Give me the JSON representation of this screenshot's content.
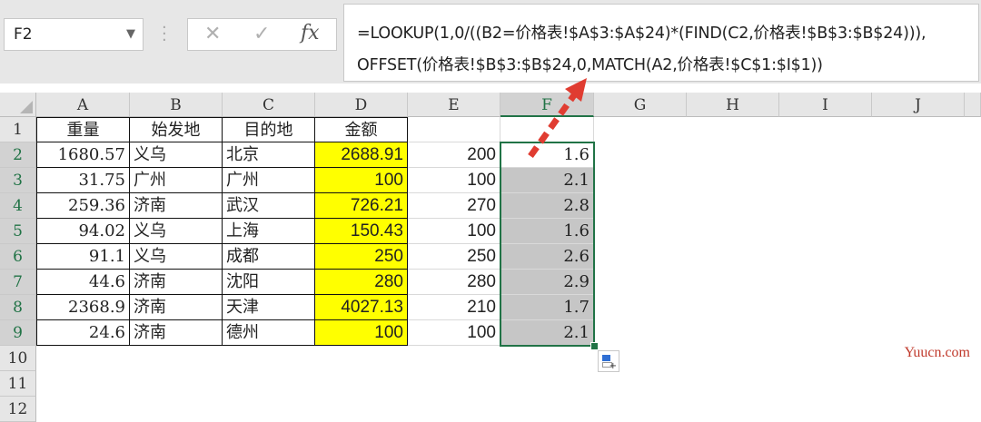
{
  "name_box": {
    "value": "F2"
  },
  "formula_bar": {
    "line1": "=LOOKUP(1,0/((B2=价格表!$A$3:$A$24)*(FIND(C2,价格表!$B$3:$B$24))),",
    "line2": "OFFSET(价格表!$B$3:$B$24,0,MATCH(A2,价格表!$C$1:$I$1))"
  },
  "columns": [
    "A",
    "B",
    "C",
    "D",
    "E",
    "F",
    "G",
    "H",
    "I",
    "J"
  ],
  "rows": [
    "1",
    "2",
    "3",
    "4",
    "5",
    "6",
    "7",
    "8",
    "9",
    "10",
    "11",
    "12"
  ],
  "headers": {
    "A": "重量",
    "B": "始发地",
    "C": "目的地",
    "D": "金额"
  },
  "table": [
    {
      "A": "1680.57",
      "B": "义乌",
      "C": "北京",
      "D": "2688.91",
      "E": "200",
      "F": "1.6"
    },
    {
      "A": "31.75",
      "B": "广州",
      "C": "广州",
      "D": "100",
      "E": "100",
      "F": "2.1"
    },
    {
      "A": "259.36",
      "B": "济南",
      "C": "武汉",
      "D": "726.21",
      "E": "270",
      "F": "2.8"
    },
    {
      "A": "94.02",
      "B": "义乌",
      "C": "上海",
      "D": "150.43",
      "E": "100",
      "F": "1.6"
    },
    {
      "A": "91.1",
      "B": "义乌",
      "C": "成都",
      "D": "250",
      "E": "250",
      "F": "2.6"
    },
    {
      "A": "44.6",
      "B": "济南",
      "C": "沈阳",
      "D": "280",
      "E": "280",
      "F": "2.9"
    },
    {
      "A": "2368.9",
      "B": "济南",
      "C": "天津",
      "D": "4027.13",
      "E": "210",
      "F": "1.7"
    },
    {
      "A": "24.6",
      "B": "济南",
      "C": "德州",
      "D": "100",
      "E": "100",
      "F": "2.1"
    }
  ],
  "selected_column": "F",
  "watermark": "Yuucn.com",
  "colors": {
    "accent": "#217346",
    "highlight_yellow": "#ffff00",
    "arrow_red": "#e03c31"
  },
  "icons": [
    "dropdown-arrow-icon",
    "cancel-icon",
    "enter-icon",
    "fx-icon",
    "quick-analysis-icon"
  ]
}
